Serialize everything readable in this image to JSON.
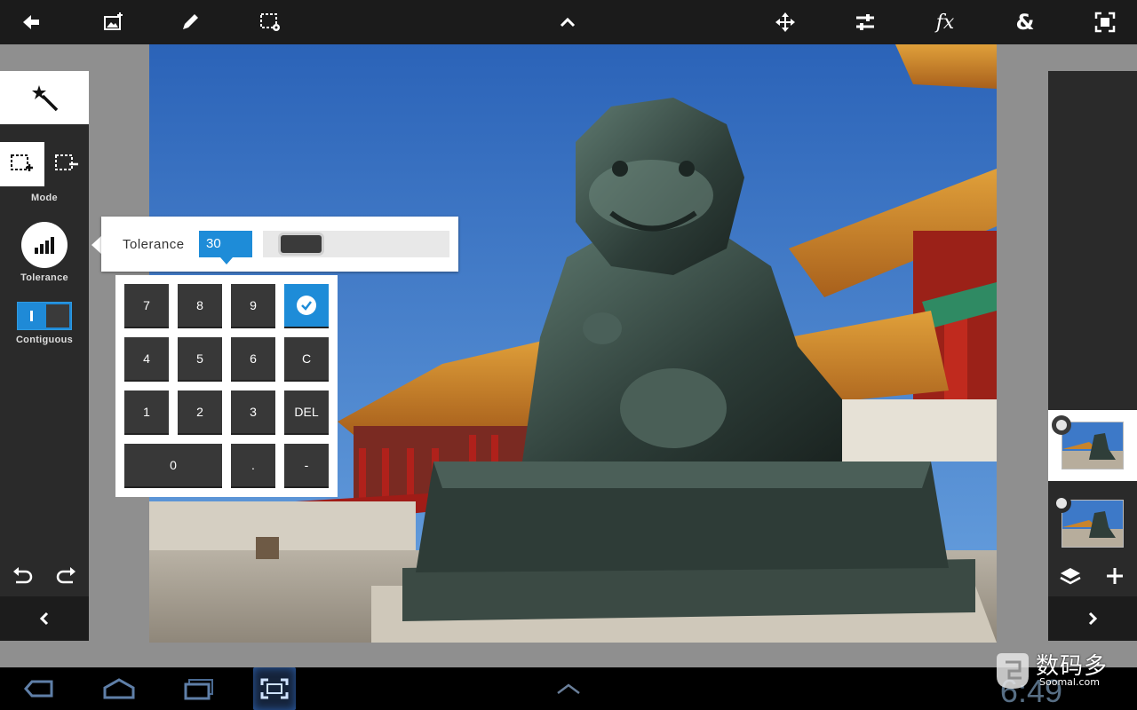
{
  "toolbar": {
    "icons": [
      "back-arrow-icon",
      "add-image-icon",
      "pencil-icon",
      "selection-settings-icon",
      "chevron-up-icon",
      "move-icon",
      "adjustments-icon",
      "fx-icon",
      "ampersand-icon",
      "fit-screen-icon"
    ],
    "fx_label": "fx",
    "amp_label": "&"
  },
  "left_panel": {
    "active_tool": "magic-wand-icon",
    "mode_label": "Mode",
    "tolerance_label": "Tolerance",
    "contiguous_label": "Contiguous",
    "contiguous_on": true
  },
  "tolerance_popup": {
    "label": "Tolerance",
    "value": "30",
    "slider_level": 0.3
  },
  "keypad": {
    "keys": [
      "7",
      "8",
      "9",
      "4",
      "5",
      "6",
      "C",
      "1",
      "2",
      "3",
      "DEL",
      "0",
      ".",
      "-"
    ]
  },
  "right_panel": {
    "layers": [
      {
        "active": true
      },
      {
        "active": false
      }
    ]
  },
  "system_bar": {
    "clock": "6:49"
  },
  "watermark": {
    "brand": "数码多",
    "site": "Soomal.com"
  },
  "colors": {
    "accent": "#1e8cd8",
    "toolbar_bg": "#1b1b1b",
    "panel_bg": "#2a2a2a"
  }
}
